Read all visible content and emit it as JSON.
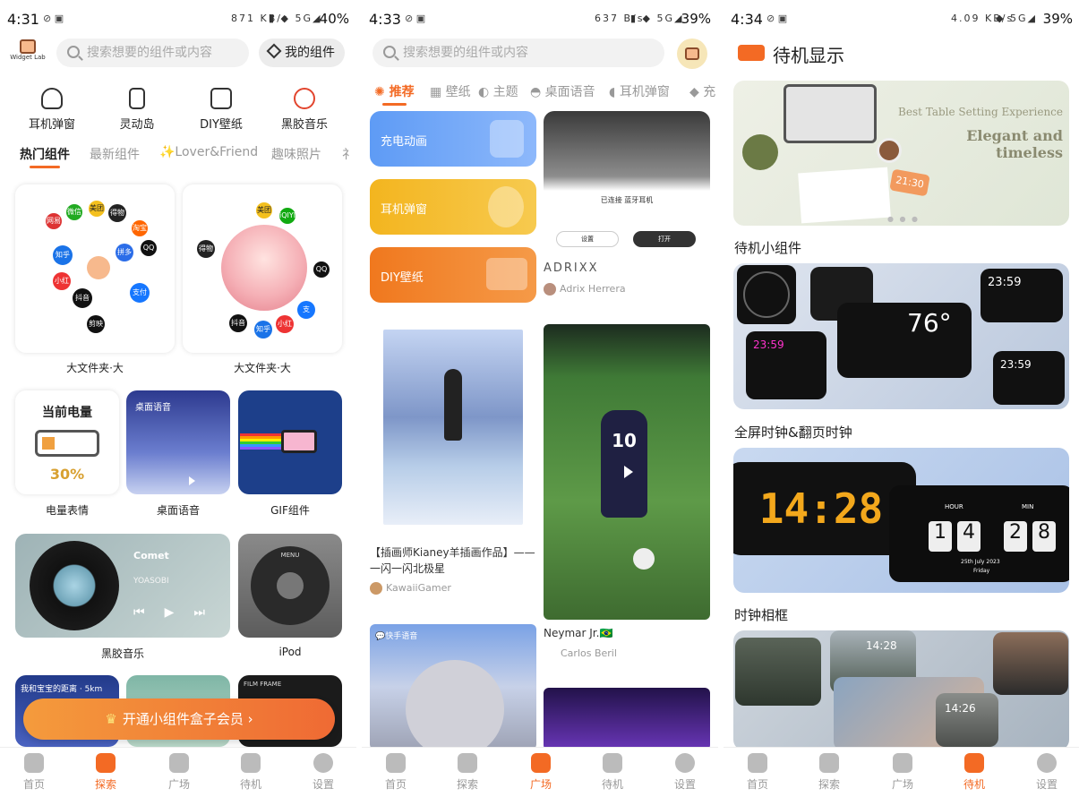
{
  "screens": [
    {
      "time": "4:31",
      "net": "871 KB/s",
      "battery": "40%",
      "logo": "Widget Lab",
      "search_placeholder": "搜索想要的组件或内容",
      "my_widgets": "我的组件",
      "quick": [
        "耳机弹窗",
        "灵动岛",
        "DIY壁纸",
        "黑胶音乐"
      ],
      "tabs": [
        "热门组件",
        "最新组件",
        "✨Lover&Friend",
        "趣味照片",
        "礻"
      ],
      "folder1": {
        "apps": [
          "网易",
          "微信",
          "得物",
          "美团",
          "知乎",
          "小红书",
          "拼多多",
          "淘宝",
          "抖音",
          "剪映",
          "支付宝",
          "QQ"
        ],
        "label": "大文件夹·大"
      },
      "folder2": {
        "apps": [
          "美团",
          "iQIYI",
          "得物",
          "抖音",
          "知乎",
          "小红书",
          "支",
          "QQ"
        ],
        "label": "大文件夹·大"
      },
      "battery_widget": {
        "title": "当前电量",
        "value": "30%",
        "label": "电量表情"
      },
      "voice_widget": {
        "title": "桌面语音",
        "label": "桌面语音"
      },
      "gif_widget": {
        "label": "GIF组件"
      },
      "music_widget": {
        "song": "Comet",
        "artist": "YOASOBI",
        "label": "黑胶音乐"
      },
      "ipod_widget": {
        "menu": "MENU",
        "label": "iPod"
      },
      "peek1": "我和宝宝的距离 · 5km",
      "peek3": "FILM FRAME",
      "vip": "开通小组件盒子会员 ›",
      "nav": [
        "首页",
        "探索",
        "广场",
        "待机",
        "设置"
      ],
      "nav_active": 1
    },
    {
      "time": "4:33",
      "net": "637 B/s",
      "battery": "39%",
      "search_placeholder": "搜索想要的组件或内容",
      "tabs": [
        "推荐",
        "壁纸",
        "主题",
        "桌面语音",
        "耳机弹窗",
        "充"
      ],
      "tiles": [
        "充电动画",
        "耳机弹窗",
        "DIY壁纸"
      ],
      "post1": {
        "device": "已连接 蓝牙耳机",
        "btn1": "设置",
        "btn2": "打开",
        "title": "ADRIXX",
        "author": "Adrix Herrera"
      },
      "post2": {
        "title": "【插画师Kianey羊插画作品】—— 一闪一闪北极星",
        "author": "KawaiiGamer"
      },
      "post3": {
        "jersey": "10",
        "title": "Neymar Jr.🇧🇷",
        "author": "Carlos Beril"
      },
      "post4": {
        "tag": "💬快手语音"
      },
      "nav": [
        "首页",
        "探索",
        "广场",
        "待机",
        "设置"
      ],
      "nav_active": 2
    },
    {
      "time": "4:34",
      "net": "4.09 KB/s",
      "battery": "39%",
      "title": "待机显示",
      "banner": {
        "line1": "Best Table Setting Experience",
        "line2": "Elegant and timeless",
        "clock": "21:30"
      },
      "sections": [
        "待机小组件",
        "全屏时钟&翻页时钟",
        "时钟相框"
      ],
      "widgets": {
        "t1": "23:59",
        "temp": "76°",
        "t2": "23:59",
        "t3": "23:59"
      },
      "clock": {
        "digits": "14:28",
        "hour_label": "HOUR",
        "min_label": "MIN",
        "flip": [
          "1",
          "4",
          "2",
          "8"
        ],
        "date": "25th July 2023",
        "day": "Friday"
      },
      "frame": {
        "t1": "14:28",
        "t2": "14:26"
      },
      "nav": [
        "首页",
        "探索",
        "广场",
        "待机",
        "设置"
      ],
      "nav_active": 3
    }
  ]
}
